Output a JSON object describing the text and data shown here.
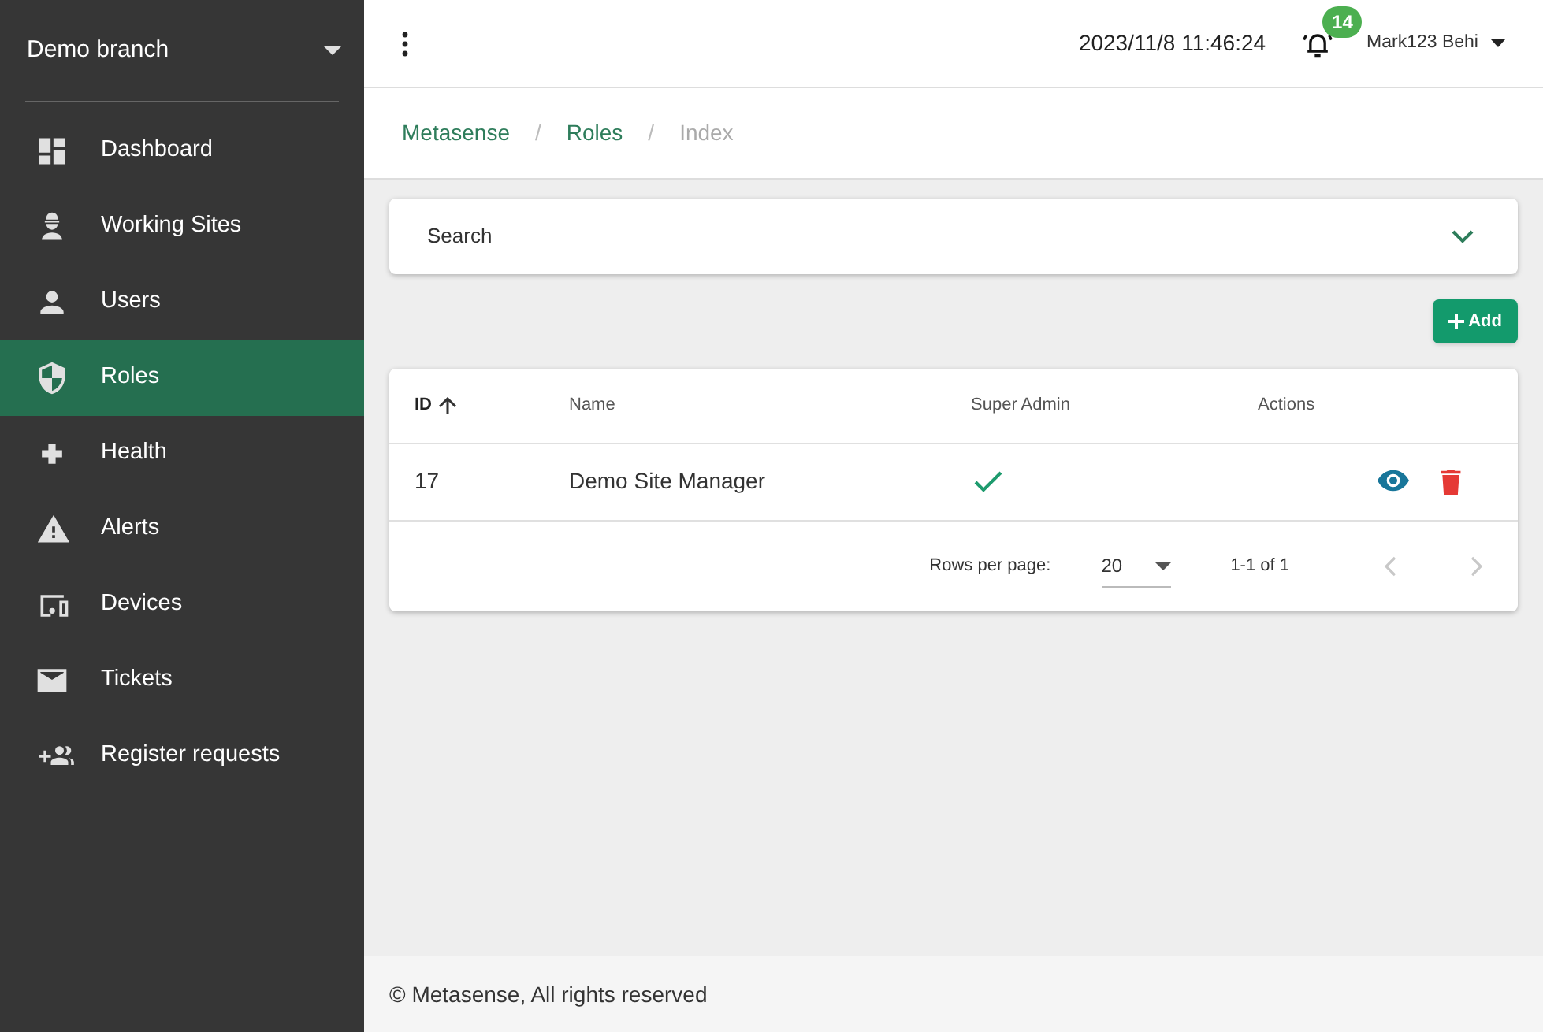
{
  "sidebar": {
    "branch": "Demo branch",
    "items": [
      {
        "label": "Dashboard",
        "selected": false
      },
      {
        "label": "Working Sites",
        "selected": false
      },
      {
        "label": "Users",
        "selected": false
      },
      {
        "label": "Roles",
        "selected": true
      },
      {
        "label": "Health",
        "selected": false
      },
      {
        "label": "Alerts",
        "selected": false
      },
      {
        "label": "Devices",
        "selected": false
      },
      {
        "label": "Tickets",
        "selected": false
      },
      {
        "label": "Register requests",
        "selected": false
      }
    ]
  },
  "header": {
    "datetime": "2023/11/8 11:46:24",
    "notification_count": "14",
    "user": "Mark123 Behi"
  },
  "breadcrumb_separator": "/",
  "breadcrumb": [
    {
      "label": "Metasense",
      "current": false
    },
    {
      "label": "Roles",
      "current": false
    },
    {
      "label": "Index",
      "current": true
    }
  ],
  "search_panel": {
    "label": "Search",
    "expanded": false
  },
  "add_button": "Add",
  "table": {
    "columns": [
      {
        "label": "ID",
        "sorted_ascending": true
      },
      {
        "label": "Name",
        "sorted_ascending": false
      },
      {
        "label": "Super Admin",
        "sorted_ascending": false
      },
      {
        "label": "Actions",
        "sorted_ascending": false
      }
    ],
    "rows": [
      {
        "id": "17",
        "name": "Demo Site Manager",
        "super_admin": true
      }
    ],
    "pagination": {
      "rows_per_page_label": "Rows per page:",
      "rows_per_page": "20",
      "range": "1-1 of 1",
      "prev_disabled": true,
      "next_disabled": true
    }
  },
  "footer": "© Metasense, All rights reserved"
}
